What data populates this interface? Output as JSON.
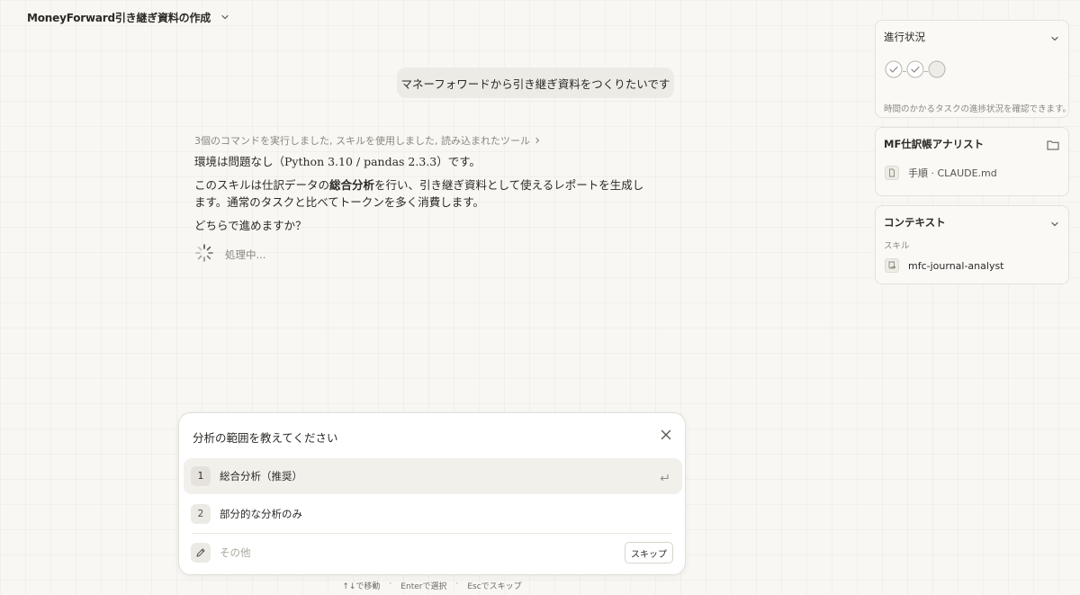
{
  "header": {
    "title": "MoneyForward引き継ぎ資料の作成"
  },
  "conversation": {
    "user_message": "マネーフォワードから引き継ぎ資料をつくりたいです",
    "tool_summary": "3個のコマンドを実行しました, スキルを使用しました, 読み込まれたツール",
    "paragraph1": "環境は問題なし（Python 3.10 / pandas 2.3.3）です。",
    "paragraph2_before": "このスキルは仕訳データの",
    "paragraph2_bold": "総合分析",
    "paragraph2_after": "を行い、引き継ぎ資料として使えるレポートを生成します。通常のタスクと比べてトークンを多く消費します。",
    "paragraph3": "どちらで進めますか？",
    "processing": "処理中..."
  },
  "sidebar": {
    "progress": {
      "title": "進行状況",
      "description": "時間のかかるタスクの進捗状況を確認できます。",
      "steps": [
        "done",
        "done",
        "pending"
      ]
    },
    "analyst": {
      "title": "MF仕訳帳アナリスト",
      "file": "手順 · CLAUDE.md"
    },
    "context": {
      "title": "コンテキスト",
      "section_label": "スキル",
      "skill": "mfc-journal-analyst"
    }
  },
  "question": {
    "title": "分析の範囲を教えてください",
    "options": [
      {
        "number": "1",
        "label": "総合分析（推奨）"
      },
      {
        "number": "2",
        "label": "部分的な分析のみ"
      }
    ],
    "other_placeholder": "その他",
    "skip_label": "スキップ"
  },
  "hints": {
    "move": "↑↓で移動",
    "select": "Enterで選択",
    "skip": "Escでスキップ"
  }
}
